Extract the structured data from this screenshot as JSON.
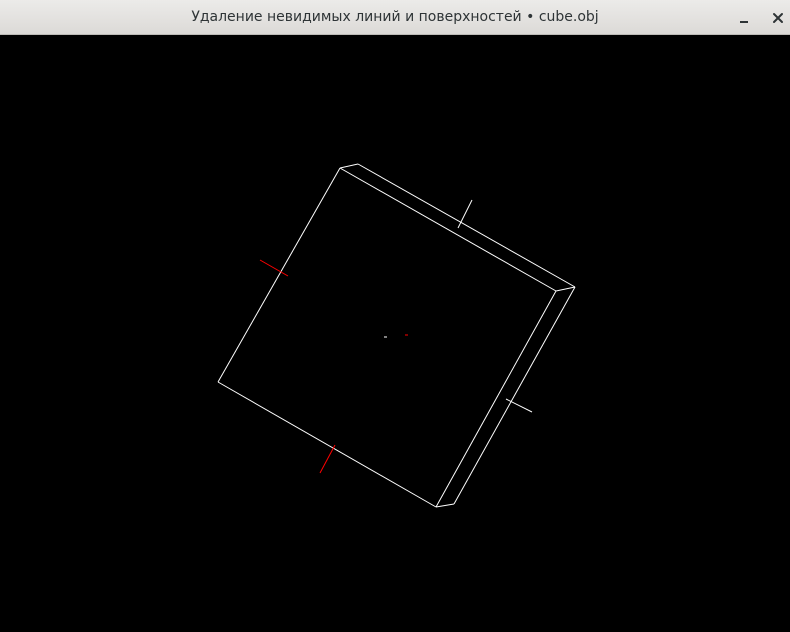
{
  "window": {
    "title": "Удаление невидимых линий и поверхностей • cube.obj",
    "minimize_icon": "minimize-icon",
    "close_icon": "close-icon"
  },
  "viewport": {
    "background": "#000000",
    "edge_color": "#ffffff",
    "normal_colors": {
      "visible": "#ffffff",
      "hidden": "#ff0000"
    }
  }
}
